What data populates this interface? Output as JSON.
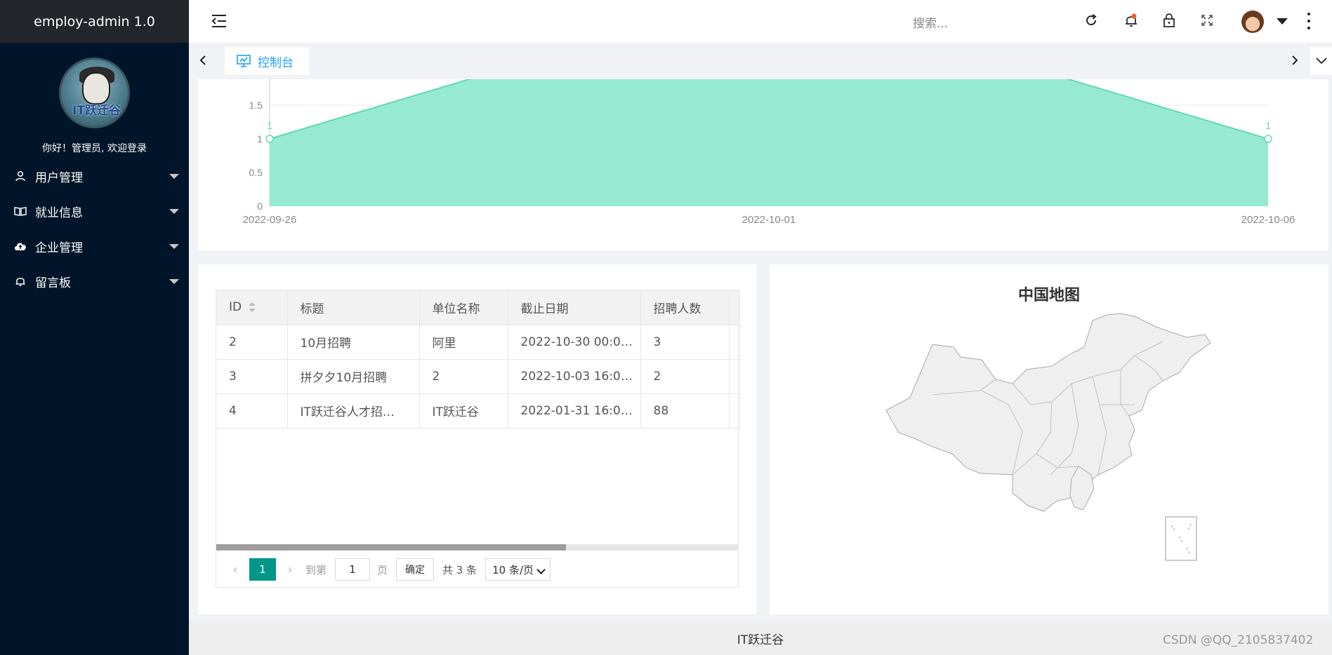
{
  "app": {
    "title": "employ-admin 1.0"
  },
  "sidebar": {
    "welcome": "你好！管理员, 欢迎登录",
    "avatar_text": "IT跃迁谷",
    "items": [
      {
        "label": "用户管理",
        "icon": "user-icon"
      },
      {
        "label": "就业信息",
        "icon": "book-icon"
      },
      {
        "label": "企业管理",
        "icon": "cloud-upload-icon"
      },
      {
        "label": "留言板",
        "icon": "bell-icon"
      }
    ]
  },
  "header": {
    "search_placeholder": "搜索...",
    "icons": [
      "menu-toggle-icon",
      "refresh-icon",
      "notification-bell-icon",
      "lock-icon",
      "fullscreen-icon",
      "user-avatar",
      "dropdown-caret-icon",
      "more-vertical-icon"
    ]
  },
  "tabs": [
    {
      "label": "控制台",
      "icon": "monitor-icon",
      "active": true
    }
  ],
  "chart_data": {
    "type": "area",
    "x": [
      "2022-09-26",
      "2022-10-01",
      "2022-10-06"
    ],
    "yticks": [
      0,
      0.5,
      1,
      1.5
    ],
    "data_labels": [
      "1",
      "1"
    ],
    "color": "#91e9d0",
    "line_color": "#62d9b3",
    "grid": true
  },
  "table": {
    "columns": [
      "ID",
      "标题",
      "单位名称",
      "截止日期",
      "招聘人数"
    ],
    "rows": [
      [
        "2",
        "10月招聘",
        "阿里",
        "2022-10-30 00:0…",
        "3"
      ],
      [
        "3",
        "拼夕夕10月招聘",
        "2",
        "2022-10-03 16:0…",
        "2"
      ],
      [
        "4",
        "IT跃迁谷人才招…",
        "IT跃迁谷",
        "2022-01-31 16:0…",
        "88"
      ]
    ],
    "pagination": {
      "current_page": "1",
      "goto_label": "到第",
      "goto_value": "1",
      "page_label": "页",
      "confirm_label": "确定",
      "total": "共 3 条",
      "page_size": "10 条/页",
      "scroll_position": 0.67
    }
  },
  "map": {
    "title": "中国地图"
  },
  "footer": {
    "text": "IT跃迁谷",
    "watermark": "CSDN @QQ_2105837402"
  }
}
